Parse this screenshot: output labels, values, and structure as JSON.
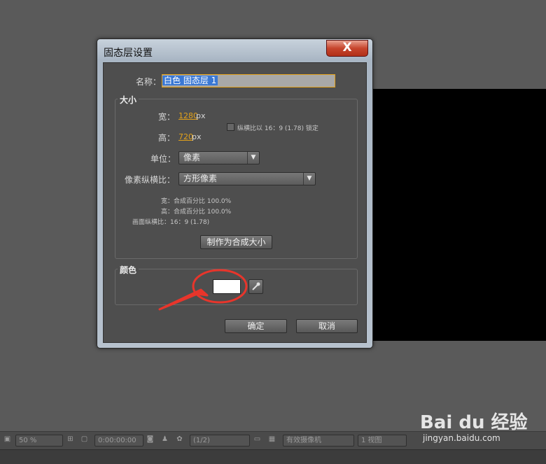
{
  "dialog": {
    "title": "固态层设置",
    "close_label": "X",
    "name_label": "名称：",
    "name_value": "白色 固态层 1",
    "size_group": {
      "title": "大小",
      "width_label": "宽：",
      "width_value": "1280",
      "width_unit": "px",
      "height_label": "高：",
      "height_value": "720",
      "height_unit": "px",
      "lock_checked": false,
      "lock_label": "纵横比以 16：9 (1.78) 锁定",
      "units_label": "单位：",
      "units_value": "像素",
      "pixel_aspect_label": "像素纵横比：",
      "pixel_aspect_value": "方形像素",
      "info_width": "宽：合成百分比 100.0%",
      "info_height": "高：合成百分比 100.0%",
      "info_frame": "画面纵横比：16：9 (1.78)",
      "make_comp_size_button": "制作为合成大小"
    },
    "color_group": {
      "title": "颜色",
      "swatch_color": "#ffffff"
    },
    "ok_button": "确定",
    "cancel_button": "取消"
  },
  "status_bar": {
    "zoom": "50 %",
    "timecode": "0:00:00:00",
    "resolution": "(1/2)",
    "camera": "有效摄像机",
    "views": "1 视图"
  },
  "annotation": {
    "color": "#e8352b"
  },
  "watermark": {
    "logo": "Bai du 经验",
    "url": "jingyan.baidu.com"
  },
  "icons": [
    "close-icon",
    "chevron-down-icon",
    "eyedropper-icon",
    "camera-icon",
    "person-icon",
    "color-icon",
    "grid-icon"
  ]
}
